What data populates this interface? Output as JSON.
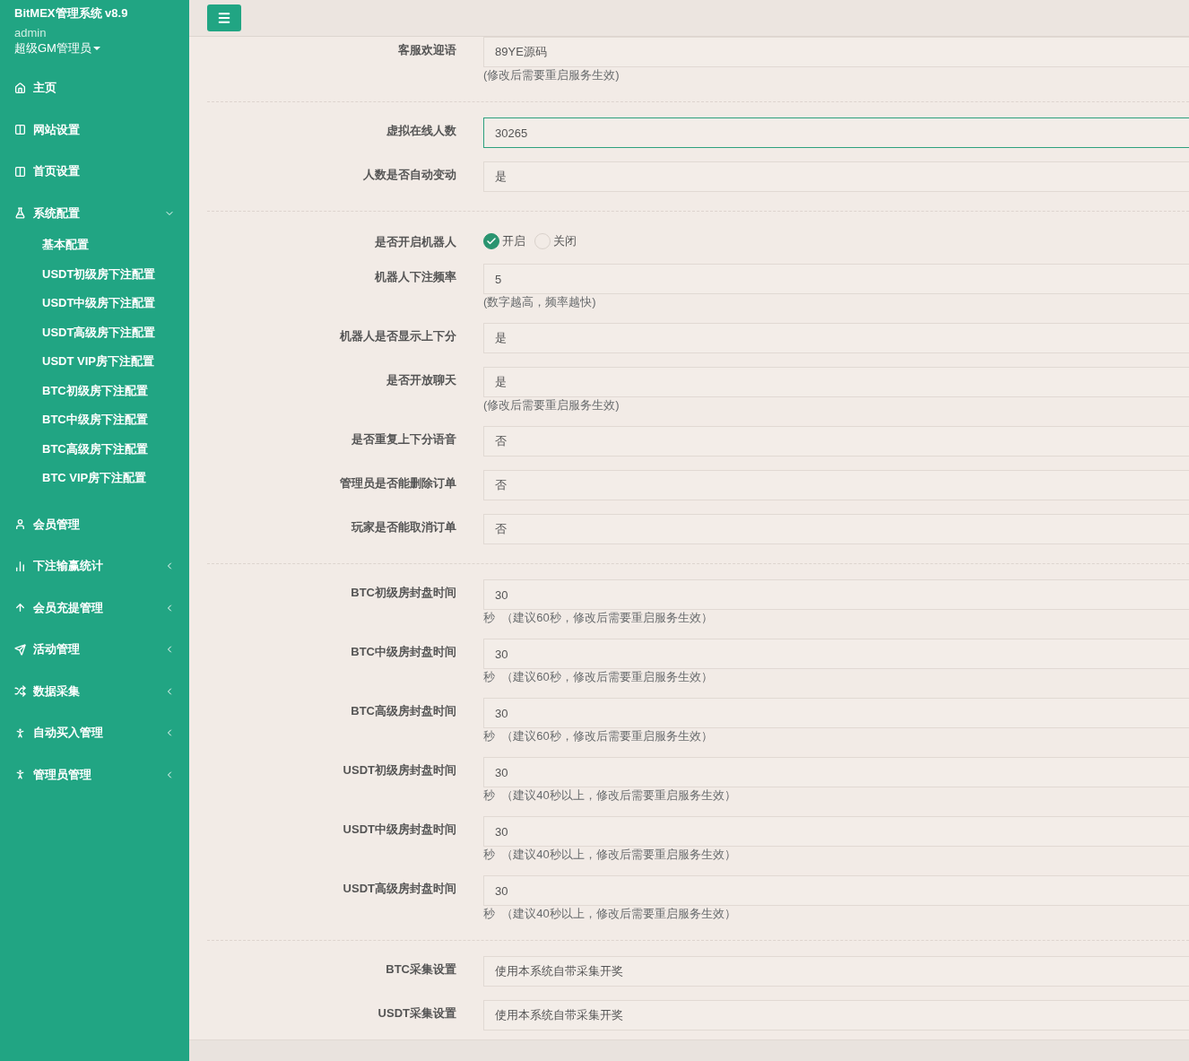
{
  "sidebar": {
    "title": "BitMEX管理系统 v8.9",
    "user": "admin",
    "role": "超级GM管理员",
    "items": [
      {
        "kind": "link",
        "label": "主页"
      },
      {
        "kind": "link",
        "label": "网站设置"
      },
      {
        "kind": "link",
        "label": "首页设置"
      },
      {
        "kind": "group",
        "label": "系统配置",
        "expanded": true,
        "children": [
          {
            "label": "基本配置"
          },
          {
            "label": "USDT初级房下注配置"
          },
          {
            "label": "USDT中级房下注配置"
          },
          {
            "label": "USDT高级房下注配置"
          },
          {
            "label": "USDT VIP房下注配置"
          },
          {
            "label": "BTC初级房下注配置"
          },
          {
            "label": "BTC中级房下注配置"
          },
          {
            "label": "BTC高级房下注配置"
          },
          {
            "label": "BTC VIP房下注配置"
          }
        ]
      },
      {
        "kind": "link",
        "label": "会员管理"
      },
      {
        "kind": "group",
        "label": "下注输赢统计",
        "expanded": false
      },
      {
        "kind": "group",
        "label": "会员充提管理",
        "expanded": false
      },
      {
        "kind": "group",
        "label": "活动管理",
        "expanded": false
      },
      {
        "kind": "group",
        "label": "数据采集",
        "expanded": false
      },
      {
        "kind": "group",
        "label": "自动买入管理",
        "expanded": false
      },
      {
        "kind": "group",
        "label": "管理员管理",
        "expanded": false
      }
    ]
  },
  "form": {
    "groups": [
      [
        {
          "kind": "text",
          "label": "客服欢迎语",
          "value": "89YE源码",
          "focused": false,
          "help": "(修改后需要重启服务生效)"
        }
      ],
      [
        {
          "kind": "text",
          "label": "虚拟在线人数",
          "value": "30265",
          "focused": true
        },
        {
          "kind": "text",
          "label": "人数是否自动变动",
          "value": "是",
          "focused": false
        }
      ],
      [
        {
          "kind": "radio",
          "label": "是否开启机器人",
          "options": [
            {
              "label": "开启",
              "selected": true
            },
            {
              "label": "关闭",
              "selected": false
            }
          ]
        },
        {
          "kind": "text",
          "label": "机器人下注频率",
          "value": "5",
          "focused": false,
          "help": "(数字越高，频率越快)"
        },
        {
          "kind": "text",
          "label": "机器人是否显示上下分",
          "value": "是",
          "focused": false
        },
        {
          "kind": "text",
          "label": "是否开放聊天",
          "value": "是",
          "focused": false,
          "help": "(修改后需要重启服务生效)"
        },
        {
          "kind": "text",
          "label": "是否重复上下分语音",
          "value": "否",
          "focused": false
        },
        {
          "kind": "text",
          "label": "管理员是否能删除订单",
          "value": "否",
          "focused": false
        },
        {
          "kind": "text",
          "label": "玩家是否能取消订单",
          "value": "否",
          "focused": false
        }
      ],
      [
        {
          "kind": "text",
          "label": "BTC初级房封盘时间",
          "value": "30",
          "focused": false,
          "help": "秒  （建议60秒，修改后需要重启服务生效）"
        },
        {
          "kind": "text",
          "label": "BTC中级房封盘时间",
          "value": "30",
          "focused": false,
          "help": "秒  （建议60秒，修改后需要重启服务生效）"
        },
        {
          "kind": "text",
          "label": "BTC高级房封盘时间",
          "value": "30",
          "focused": false,
          "help": "秒  （建议60秒，修改后需要重启服务生效）"
        },
        {
          "kind": "text",
          "label": "USDT初级房封盘时间",
          "value": "30",
          "focused": false,
          "help": "秒  （建议40秒以上，修改后需要重启服务生效）"
        },
        {
          "kind": "text",
          "label": "USDT中级房封盘时间",
          "value": "30",
          "focused": false,
          "help": "秒  （建议40秒以上，修改后需要重启服务生效）"
        },
        {
          "kind": "text",
          "label": "USDT高级房封盘时间",
          "value": "30",
          "focused": false,
          "help": "秒  （建议40秒以上，修改后需要重启服务生效）"
        }
      ],
      [
        {
          "kind": "text",
          "label": "BTC采集设置",
          "value": "使用本系统自带采集开奖",
          "focused": false
        },
        {
          "kind": "text",
          "label": "USDT采集设置",
          "value": "使用本系统自带采集开奖",
          "focused": false
        }
      ]
    ]
  }
}
